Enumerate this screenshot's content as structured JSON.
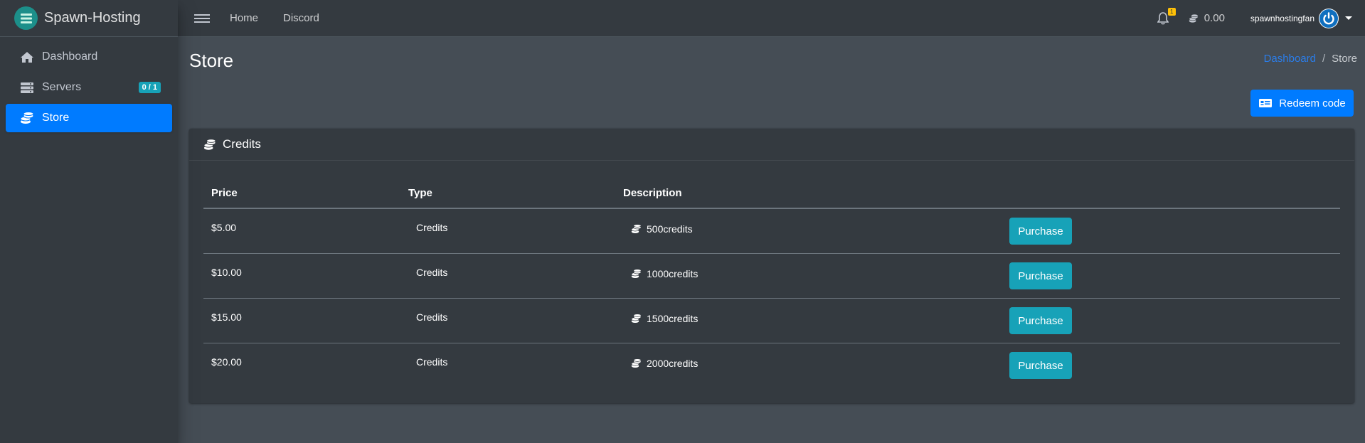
{
  "brand": {
    "name": "Spawn-Hosting",
    "logo_icon": "server-stack-logo"
  },
  "sidebar": {
    "items": [
      {
        "label": "Dashboard",
        "icon": "home-icon",
        "active": false
      },
      {
        "label": "Servers",
        "icon": "server-icon",
        "badge": "0 / 1",
        "active": false
      },
      {
        "label": "Store",
        "icon": "coins-icon",
        "active": true
      }
    ]
  },
  "topbar": {
    "links": [
      "Home",
      "Discord"
    ],
    "notifications_count": "1",
    "credits": "0.00",
    "username": "spawnhostingfan"
  },
  "page": {
    "title": "Store",
    "breadcrumb": {
      "home": "Dashboard",
      "separator": "/",
      "current": "Store"
    },
    "redeem_label": "Redeem code"
  },
  "card": {
    "title": "Credits",
    "headers": {
      "price": "Price",
      "type": "Type",
      "description": "Description"
    },
    "rows": [
      {
        "price": "$5.00",
        "type": "Credits",
        "description": "500credits",
        "action": "Purchase"
      },
      {
        "price": "$10.00",
        "type": "Credits",
        "description": "1000credits",
        "action": "Purchase"
      },
      {
        "price": "$15.00",
        "type": "Credits",
        "description": "1500credits",
        "action": "Purchase"
      },
      {
        "price": "$20.00",
        "type": "Credits",
        "description": "2000credits",
        "action": "Purchase"
      }
    ]
  },
  "colors": {
    "primary": "#007bff",
    "info": "#17a2b8",
    "sidebar_bg": "#343a40",
    "content_bg": "#454d55",
    "warning": "#ffc107"
  }
}
